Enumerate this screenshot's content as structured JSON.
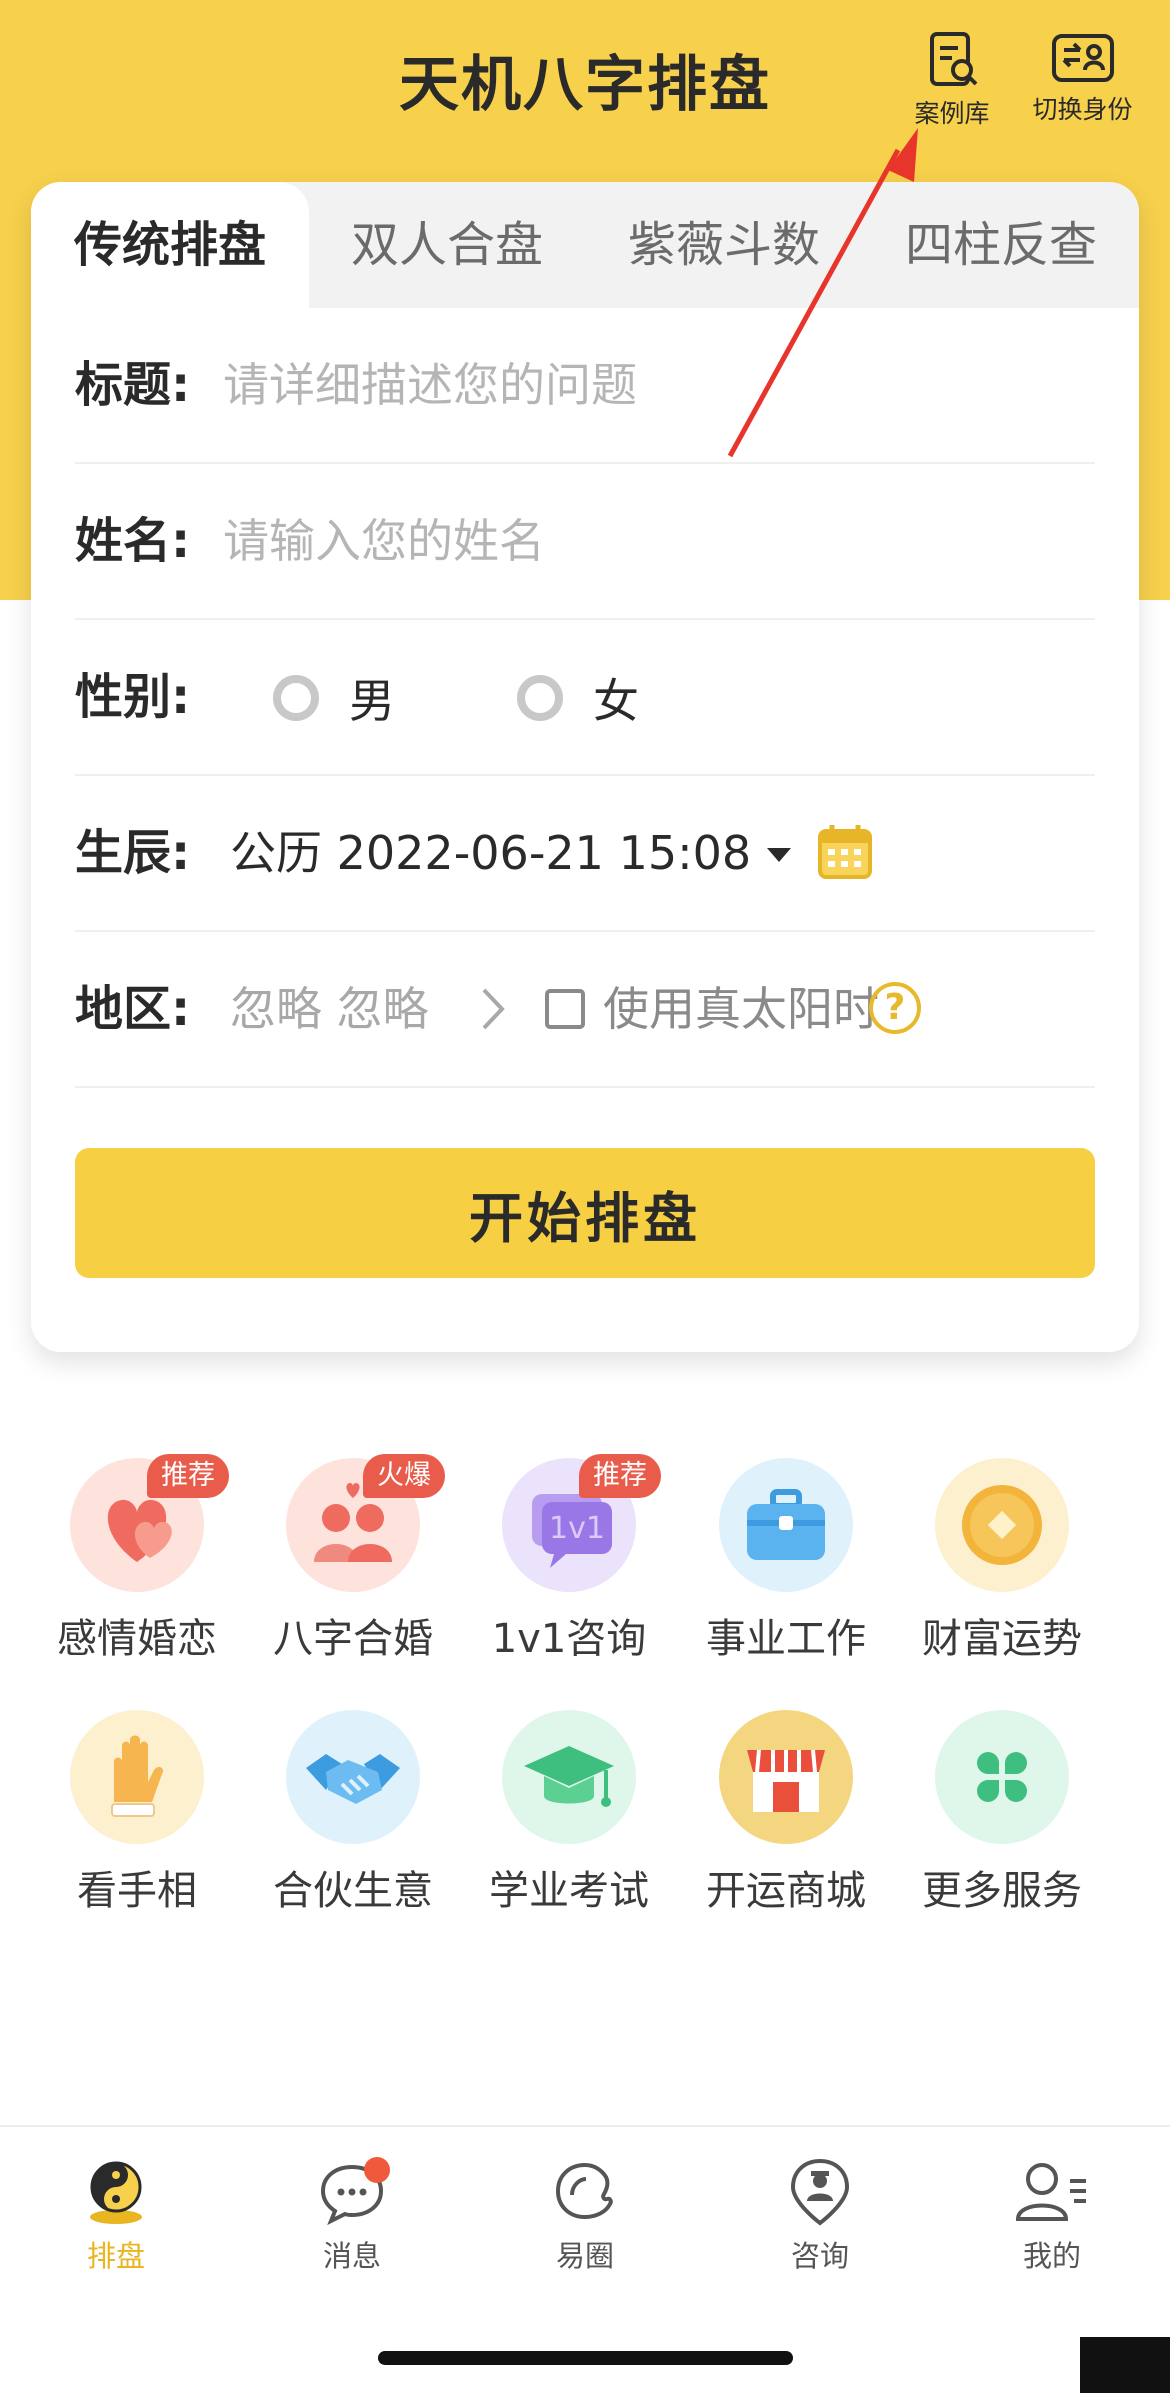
{
  "header": {
    "title": "天机八字排盘",
    "case_library": "案例库",
    "switch_identity": "切换身份"
  },
  "tabs": [
    "传统排盘",
    "双人合盘",
    "紫薇斗数",
    "四柱反查"
  ],
  "form": {
    "title_label": "标题:",
    "title_placeholder": "请详细描述您的问题",
    "name_label": "姓名:",
    "name_placeholder": "请输入您的姓名",
    "gender_label": "性别:",
    "gender_male": "男",
    "gender_female": "女",
    "birth_label": "生辰:",
    "birth_value": "公历 2022-06-21 15:08",
    "region_label": "地区:",
    "region_value": "忽略 忽略",
    "true_solar_time": "使用真太阳时",
    "help": "?",
    "start_button": "开始排盘"
  },
  "services": [
    {
      "label": "感情婚恋",
      "badge": "推荐",
      "icon": "heart-icon"
    },
    {
      "label": "八字合婚",
      "badge": "火爆",
      "icon": "couple-icon"
    },
    {
      "label": "1v1咨询",
      "badge": "推荐",
      "icon": "chat-1v1-icon"
    },
    {
      "label": "事业工作",
      "badge": "",
      "icon": "briefcase-icon"
    },
    {
      "label": "财富运势",
      "badge": "",
      "icon": "coin-icon"
    },
    {
      "label": "看手相",
      "badge": "",
      "icon": "palm-icon"
    },
    {
      "label": "合伙生意",
      "badge": "",
      "icon": "handshake-icon"
    },
    {
      "label": "学业考试",
      "badge": "",
      "icon": "graduation-cap-icon"
    },
    {
      "label": "开运商城",
      "badge": "",
      "icon": "shop-icon"
    },
    {
      "label": "更多服务",
      "badge": "",
      "icon": "clover-icon"
    }
  ],
  "bottom_nav": [
    {
      "label": "排盘",
      "icon": "yin-yang-icon",
      "active": true
    },
    {
      "label": "消息",
      "icon": "message-icon",
      "active": false
    },
    {
      "label": "易圈",
      "icon": "circle-chat-icon",
      "active": false
    },
    {
      "label": "咨询",
      "icon": "consult-icon",
      "active": false
    },
    {
      "label": "我的",
      "icon": "profile-icon",
      "active": false
    }
  ],
  "colors": {
    "brand_yellow": "#f7d04c",
    "badge_red": "#e95c4b",
    "active_nav": "#e9b520",
    "annotation_arrow": "#e8352b"
  }
}
